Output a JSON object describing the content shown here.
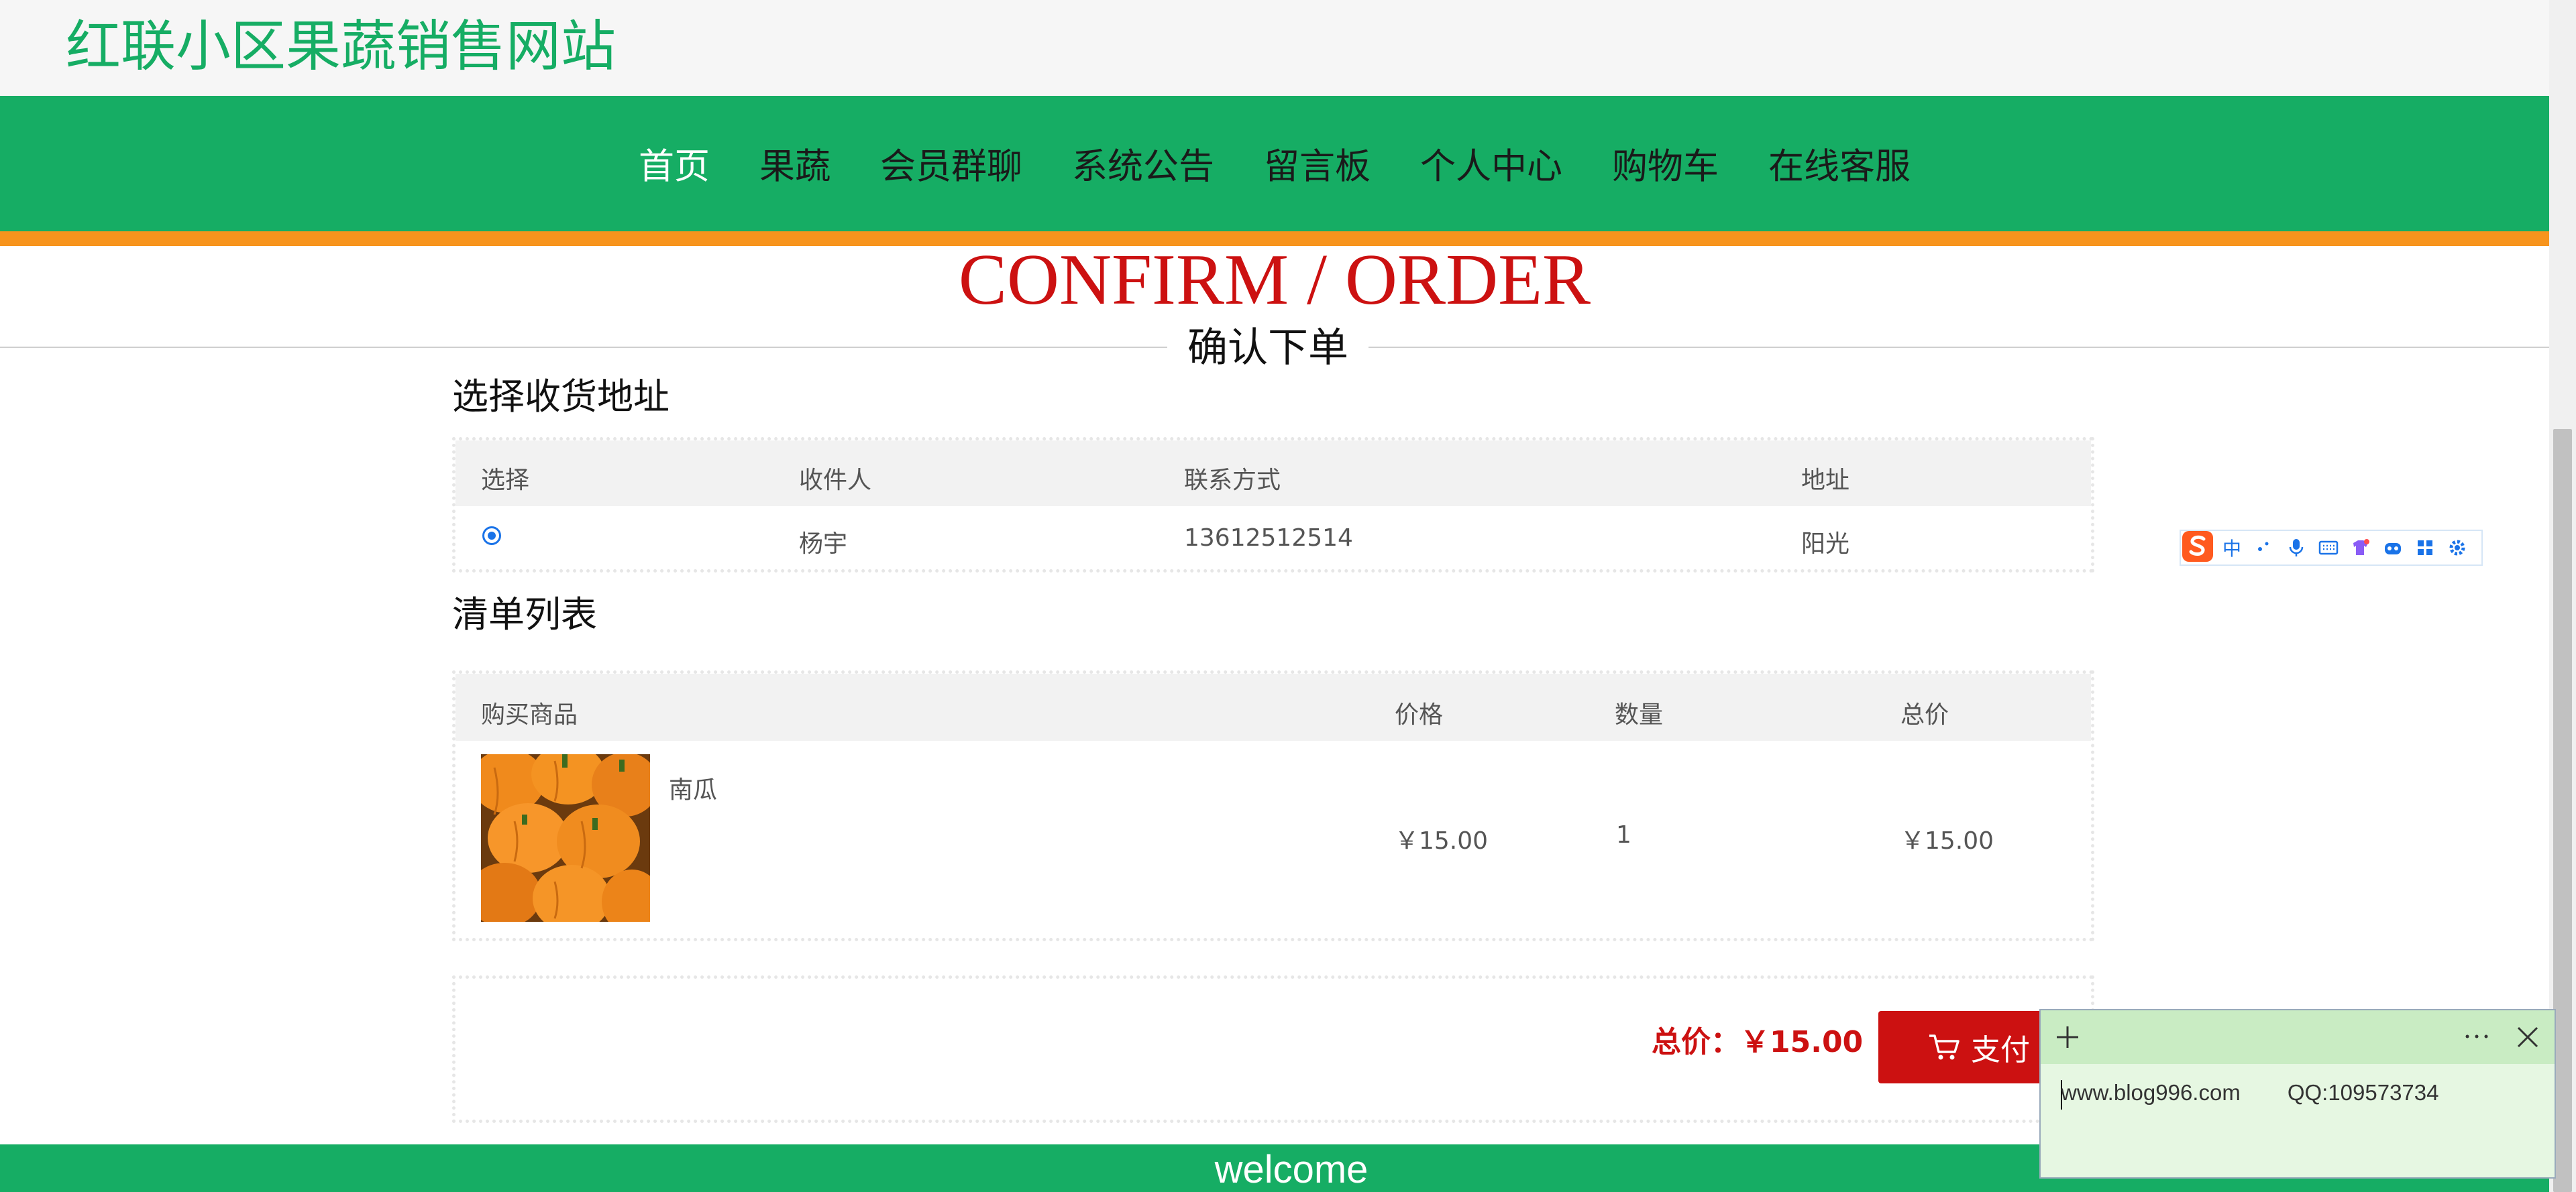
{
  "site": {
    "title": "红联小区果蔬销售网站"
  },
  "nav": {
    "items": [
      {
        "label": "首页"
      },
      {
        "label": "果蔬"
      },
      {
        "label": "会员群聊"
      },
      {
        "label": "系统公告"
      },
      {
        "label": "留言板"
      },
      {
        "label": "个人中心"
      },
      {
        "label": "购物车"
      },
      {
        "label": "在线客服"
      }
    ],
    "active_index": 0
  },
  "hero": {
    "title_en": "CONFIRM / ORDER",
    "title_cn": "确认下单"
  },
  "address": {
    "section_title": "选择收货地址",
    "headers": [
      "选择",
      "收件人",
      "联系方式",
      "地址"
    ],
    "rows": [
      {
        "selected": true,
        "recipient": "杨宇",
        "phone": "13612512514",
        "address": "阳光"
      }
    ]
  },
  "orders": {
    "section_title": "清单列表",
    "headers": [
      "购买商品",
      "价格",
      "数量",
      "总价"
    ],
    "rows": [
      {
        "name": "南瓜",
        "price": "￥15.00",
        "qty": "1",
        "subtotal": "￥15.00",
        "image": "pumpkin-photo"
      }
    ]
  },
  "payment": {
    "total_label": "总价：",
    "total_value": "￥15.00",
    "pay_label": "支付"
  },
  "footer": {
    "text": "welcome"
  },
  "ime_toolbar": {
    "mode": "中",
    "icons": [
      "sogou-logo-icon",
      "punctuation-icon",
      "microphone-icon",
      "keyboard-icon",
      "skin-icon",
      "robot-icon",
      "apps-icon",
      "settings-icon"
    ]
  },
  "sticky_note": {
    "site": "www.blog996.com",
    "qq": "QQ:109573734"
  },
  "colors": {
    "brand_green": "#16ad64",
    "accent_orange": "#f7941d",
    "price_red": "#cc1111"
  }
}
